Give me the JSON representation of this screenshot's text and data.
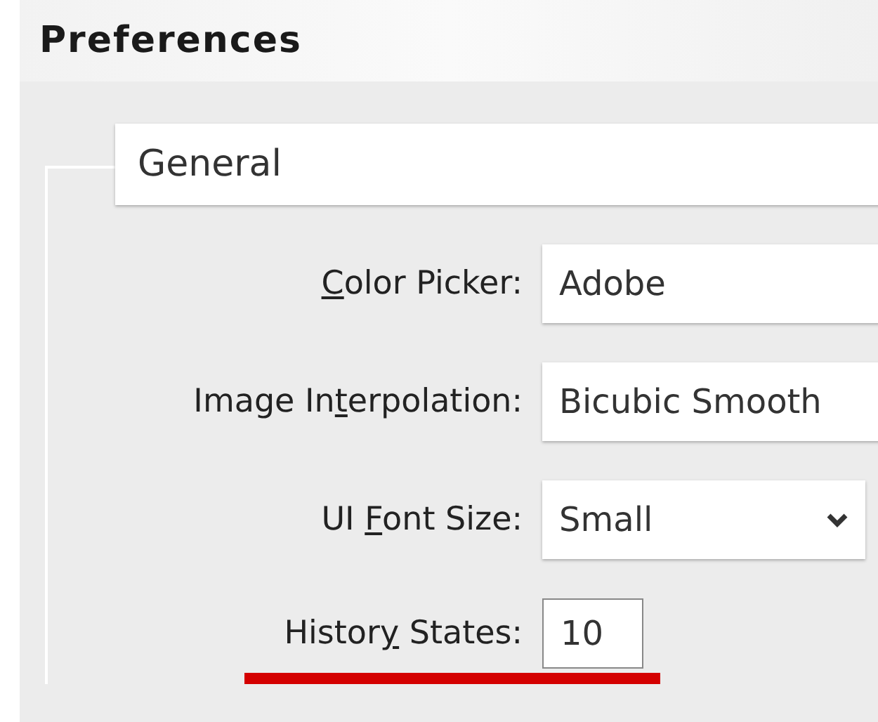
{
  "window": {
    "title": "Preferences"
  },
  "panel": {
    "value": "General"
  },
  "fields": [
    {
      "access_key": "C",
      "label_post": "olor Picker:",
      "value": "Adobe",
      "kind": "wide",
      "highlighted": false
    },
    {
      "label_pre": "Image In",
      "access_key": "t",
      "label_post": "erpolation:",
      "value": "Bicubic Smooth",
      "kind": "wide",
      "highlighted": false
    },
    {
      "label_pre": "UI ",
      "access_key": "F",
      "label_post": "ont Size:",
      "value": "Small",
      "kind": "dropdown",
      "highlighted": false
    },
    {
      "label_pre": "Histor",
      "access_key": "y",
      "label_post": " States:",
      "value": "10",
      "kind": "number",
      "highlighted": true
    }
  ]
}
